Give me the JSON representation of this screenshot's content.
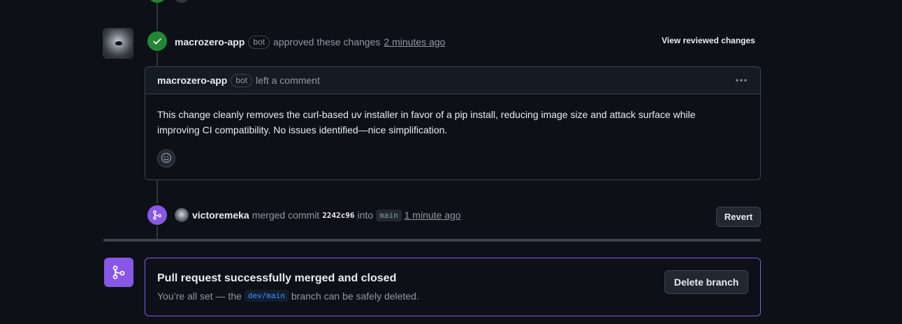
{
  "review_event": {
    "author": "macrozero-app",
    "bot_label": "bot",
    "action": "approved these changes",
    "time": "2 minutes ago",
    "view_reviewed_label": "View reviewed changes"
  },
  "comment": {
    "author": "macrozero-app",
    "bot_label": "bot",
    "action": "left a comment",
    "menu_icon": "kebab-horizontal-icon",
    "body_line1": "This change cleanly removes the curl-based uv installer in favor of a pip install, reducing image size and attack surface while",
    "body_line2": "improving CI compatibility. No issues identified—nice simplification.",
    "reaction_icon": "smiley-icon"
  },
  "merge_event": {
    "author": "victoremeka",
    "action": "merged commit",
    "sha": "2242c96",
    "into_word": "into",
    "branch": "main",
    "time": "1 minute ago",
    "revert_label": "Revert"
  },
  "merged_panel": {
    "title": "Pull request successfully merged and closed",
    "sub_prefix": "You’re all set — the",
    "branch": "dev/main",
    "sub_suffix": "branch can be safely deleted.",
    "delete_label": "Delete branch"
  },
  "colors": {
    "background": "#0d1117",
    "approved_green": "#238636",
    "merged_purple": "#8957e5",
    "link_blue": "#4493f8"
  }
}
